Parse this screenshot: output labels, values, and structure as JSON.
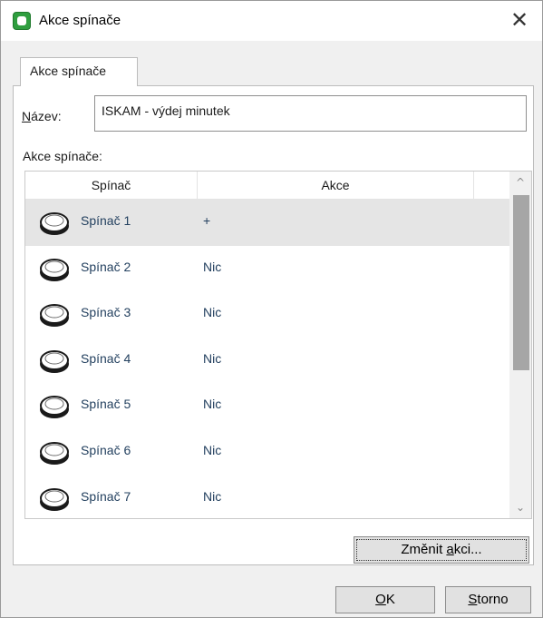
{
  "window": {
    "title": "Akce spínače",
    "close_glyph": "✕",
    "icon": "app-icon"
  },
  "tabs": [
    {
      "label": "Akce spínače",
      "active": true
    }
  ],
  "form": {
    "name_label_underlined": "N",
    "name_label_rest": "ázev:",
    "name_value": "ISKAM - výdej minutek",
    "actions_label": "Akce spínače:"
  },
  "list": {
    "columns": [
      "Spínač",
      "Akce"
    ],
    "rows": [
      {
        "switch": "Spínač 1",
        "action": "+",
        "selected": true
      },
      {
        "switch": "Spínač 2",
        "action": "Nic",
        "selected": false
      },
      {
        "switch": "Spínač 3",
        "action": "Nic",
        "selected": false
      },
      {
        "switch": "Spínač 4",
        "action": "Nic",
        "selected": false
      },
      {
        "switch": "Spínač 5",
        "action": "Nic",
        "selected": false
      },
      {
        "switch": "Spínač 6",
        "action": "Nic",
        "selected": false
      },
      {
        "switch": "Spínač 7",
        "action": "Nic",
        "selected": false
      }
    ],
    "row_icon": "push-button-icon",
    "scroll_up_glyph": "^",
    "scroll_down_glyph": "⌄"
  },
  "buttons": {
    "change_pre": "Změnit ",
    "change_underlined": "a",
    "change_post": "kci...",
    "ok_underlined": "O",
    "ok_post": "K",
    "cancel_underlined": "S",
    "cancel_post": "torno"
  },
  "colors": {
    "icon_green": "#2f9e3f",
    "row_text": "#23405f",
    "selected_row": "#e5e5e5"
  }
}
